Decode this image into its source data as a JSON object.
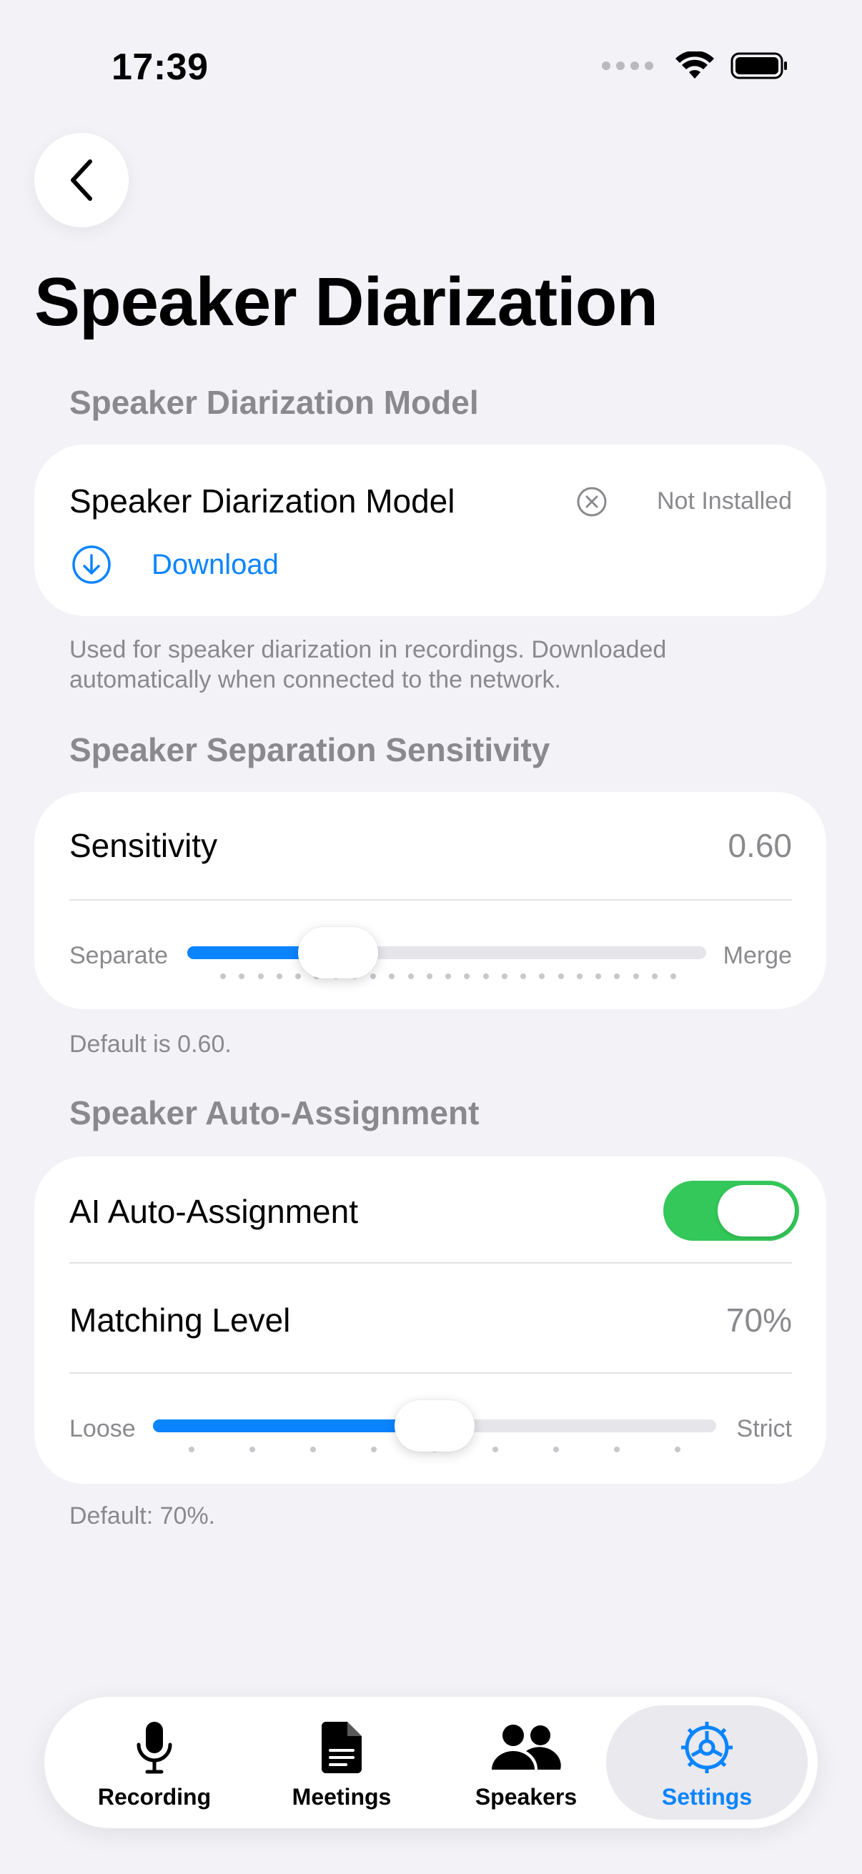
{
  "status": {
    "time": "17:39"
  },
  "page": {
    "title": "Speaker Diarization"
  },
  "model_section": {
    "header": "Speaker Diarization Model",
    "model_label": "Speaker Diarization Model",
    "status": "Not Installed",
    "download_label": "Download",
    "footnote": "Used for speaker diarization in recordings. Downloaded automatically when connected to the network."
  },
  "sensitivity_section": {
    "header": "Speaker Separation Sensitivity",
    "label": "Sensitivity",
    "value": "0.60",
    "slider_min_label": "Separate",
    "slider_max_label": "Merge",
    "slider_fraction": 0.29,
    "footnote": "Default is 0.60."
  },
  "assignment_section": {
    "header": "Speaker Auto-Assignment",
    "toggle_label": "AI Auto-Assignment",
    "toggle_on": true,
    "matching_label": "Matching Level",
    "matching_value": "70%",
    "slider_min_label": "Loose",
    "slider_max_label": "Strict",
    "slider_fraction": 0.5,
    "footnote": "Default: 70%."
  },
  "tabs": [
    {
      "label": "Recording",
      "icon": "microphone-icon"
    },
    {
      "label": "Meetings",
      "icon": "document-icon"
    },
    {
      "label": "Speakers",
      "icon": "people-icon"
    },
    {
      "label": "Settings",
      "icon": "gear-icon",
      "active": true
    }
  ],
  "colors": {
    "accent": "#0a84ff",
    "toggle_on": "#34c759",
    "secondary_text": "#8a8a8e",
    "background": "#f2f2f7"
  }
}
